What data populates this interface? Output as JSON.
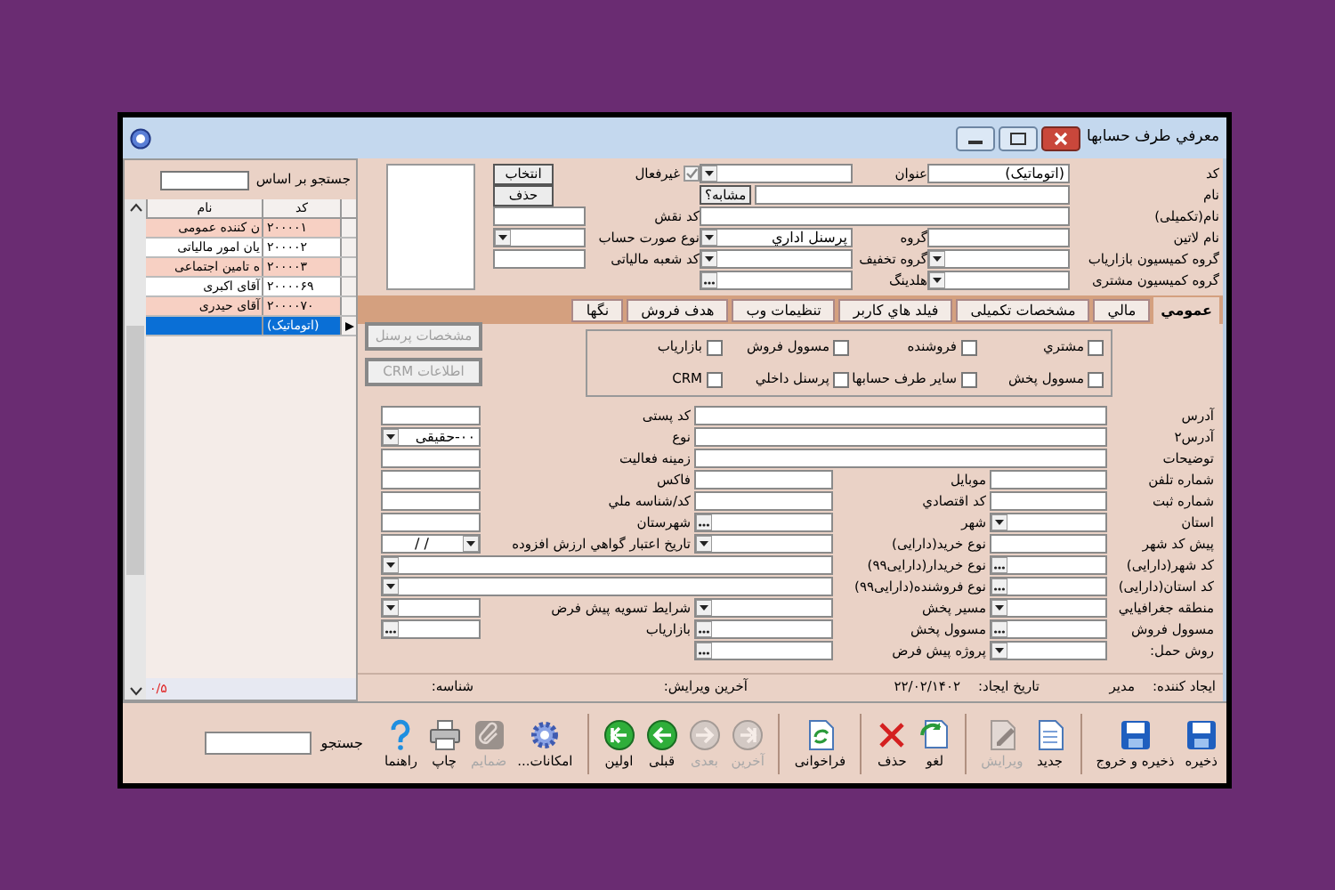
{
  "window": {
    "title": "معرفي طرف حسابها"
  },
  "header": {
    "code": {
      "label": "کد",
      "value": "(اتوماتیک)"
    },
    "name": {
      "label": "نام"
    },
    "full_name": {
      "label": "نام(تکمیلی)"
    },
    "latin_name": {
      "label": "نام لاتین"
    },
    "marketer_commission_group": {
      "label": "گروه کمیسیون بازاریاب"
    },
    "customer_commission_group": {
      "label": "گروه کمیسیون مشتری"
    },
    "title_field": {
      "label": "عنوان"
    },
    "similar_button": "مشابه؟",
    "group": {
      "label": "گروه",
      "value": "پرسنل اداري"
    },
    "discount_group": {
      "label": "گروه تخفیف"
    },
    "holding": {
      "label": "هلدینگ"
    },
    "inactive": {
      "label": "غیرفعال",
      "checked": true
    },
    "role_code": {
      "label": "کد نقش"
    },
    "invoice_type": {
      "label": "نوع صورت حساب"
    },
    "tax_branch_code": {
      "label": "کد شعبه مالیاتی"
    },
    "photo_buttons": [
      "انتخاب",
      "حذف"
    ]
  },
  "tabs": [
    {
      "label": "عمومي",
      "selected": true
    },
    {
      "label": "مالي",
      "selected": false
    },
    {
      "label": "مشخصات تکمیلی",
      "selected": false
    },
    {
      "label": "فیلد هاي کاربر",
      "selected": false
    },
    {
      "label": "تنظیمات وب",
      "selected": false
    },
    {
      "label": "هدف فروش",
      "selected": false
    },
    {
      "label": "نگها",
      "selected": false
    }
  ],
  "roles": [
    {
      "label": "مشتري",
      "checked": false
    },
    {
      "label": "فروشنده",
      "checked": false
    },
    {
      "label": "مسوول فروش",
      "checked": false
    },
    {
      "label": "بازاریاب",
      "checked": false
    },
    {
      "label": "مسوول پخش",
      "checked": false
    },
    {
      "label": "سایر طرف حسابها",
      "checked": false
    },
    {
      "label": "پرسنل داخلي",
      "checked": false
    },
    {
      "label": "CRM",
      "checked": false
    }
  ],
  "side_buttons": [
    {
      "label": "مشخصات پرسنل",
      "disabled": true
    },
    {
      "label": "اطلاعات CRM",
      "disabled": true
    }
  ],
  "form_rows": [
    [
      {
        "label": "آدرس",
        "kind": "text"
      },
      {
        "label": "کد پستی",
        "kind": "text"
      }
    ],
    [
      {
        "label": "آدرس۲",
        "kind": "text"
      },
      {
        "label": "نوع",
        "kind": "dropdown",
        "value": "۰۰-حقیقی"
      }
    ],
    [
      {
        "label": "توضیحات",
        "kind": "text"
      },
      {
        "label": "زمینه فعالیت",
        "kind": "text"
      }
    ],
    [
      {
        "label": "شماره تلفن",
        "kind": "text"
      },
      {
        "label": "موبایل",
        "kind": "text"
      },
      {
        "label": "فاکس",
        "kind": "text"
      }
    ],
    [
      {
        "label": "شماره ثبت",
        "kind": "text"
      },
      {
        "label": "کد اقتصادي",
        "kind": "text"
      },
      {
        "label": "کد/شناسه ملي",
        "kind": "text"
      }
    ],
    [
      {
        "label": "استان",
        "kind": "dropdown"
      },
      {
        "label": "شهر",
        "kind": "lookup"
      },
      {
        "label": "شهرستان",
        "kind": "text"
      }
    ],
    [
      {
        "label": "پیش کد شهر",
        "kind": "text"
      },
      {
        "label": "نوع خرید(دارایی)",
        "kind": "dropdown"
      },
      {
        "label": "تاریخ اعتبار گواهي ارزش افزوده",
        "kind": "date",
        "value": "/  /"
      }
    ],
    [
      {
        "label": "کد شهر(دارایی)",
        "kind": "lookup"
      },
      {
        "label": "نوع خریدار(دارایی۹۹)",
        "kind": "dropdown"
      }
    ],
    [
      {
        "label": "کد استان(دارایی)",
        "kind": "lookup"
      },
      {
        "label": "نوع فروشنده(دارایی۹۹)",
        "kind": "dropdown"
      }
    ],
    [
      {
        "label": "منطقه جغرافیایي",
        "kind": "dropdown"
      },
      {
        "label": "مسیر پخش",
        "kind": "dropdown"
      },
      {
        "label": "شرایط تسویه پیش فرض",
        "kind": "dropdown"
      }
    ],
    [
      {
        "label": "مسوول فروش",
        "kind": "lookup"
      },
      {
        "label": "مسوول پخش",
        "kind": "lookup"
      },
      {
        "label": "بازاریاب",
        "kind": "lookup"
      }
    ],
    [
      {
        "label": "روش حمل:",
        "kind": "dropdown"
      },
      {
        "label": "پروژه پیش فرض",
        "kind": "lookup"
      }
    ]
  ],
  "record_info": [
    {
      "label": "ایجاد کننده:",
      "value": "مدیر"
    },
    {
      "label": "تاریخ ایجاد:",
      "value": "۲۲/۰۲/۱۴۰۲"
    },
    {
      "label": "آخرین ویرایش:"
    },
    {
      "label": "شناسه:"
    }
  ],
  "toolbar": [
    {
      "label": "ذخیره",
      "kind": "save",
      "disabled": false
    },
    {
      "label": "ذخیره و خروج",
      "kind": "save",
      "disabled": false
    },
    {
      "label": "جدید",
      "kind": "new",
      "disabled": false
    },
    {
      "label": "ویرایش",
      "kind": "edit",
      "disabled": true
    },
    {
      "label": "لغو",
      "kind": "cancel",
      "disabled": false
    },
    {
      "label": "حذف",
      "kind": "delete",
      "disabled": false
    },
    {
      "label": "فراخوانی",
      "kind": "refresh",
      "disabled": false
    },
    {
      "label": "آخرین",
      "kind": "last",
      "disabled": true
    },
    {
      "label": "بعدی",
      "kind": "next",
      "disabled": true
    },
    {
      "label": "قبلی",
      "kind": "previous",
      "disabled": false
    },
    {
      "label": "اولین",
      "kind": "first",
      "disabled": false
    },
    {
      "label": "امکانات...",
      "kind": "gear",
      "disabled": false
    },
    {
      "label": "ضمایم",
      "kind": "attach",
      "disabled": true
    },
    {
      "label": "چاپ",
      "kind": "print",
      "disabled": false
    },
    {
      "label": "راهنما",
      "kind": "help",
      "disabled": false
    }
  ],
  "search": {
    "label": "جستجو"
  },
  "list": {
    "search_label": "جستجو بر اساس",
    "columns": [
      "کد",
      "نام"
    ],
    "rows": [
      {
        "code": "۲۰۰۰۰۱",
        "name": "ن کننده عمومی",
        "selected": false
      },
      {
        "code": "۲۰۰۰۰۲",
        "name": "یان امور مالیاتی",
        "selected": false
      },
      {
        "code": "۲۰۰۰۰۳",
        "name": "ه تامین اجتماعی",
        "selected": false
      },
      {
        "code": "۲۰۰۰۰۶۹",
        "name": "آقای اکبری",
        "selected": false
      },
      {
        "code": "۲۰۰۰۰۷۰",
        "name": "آقای حیدری",
        "selected": false
      },
      {
        "code": "(اتوماتیک)",
        "selected": true
      }
    ],
    "footer": "۰/۵"
  }
}
